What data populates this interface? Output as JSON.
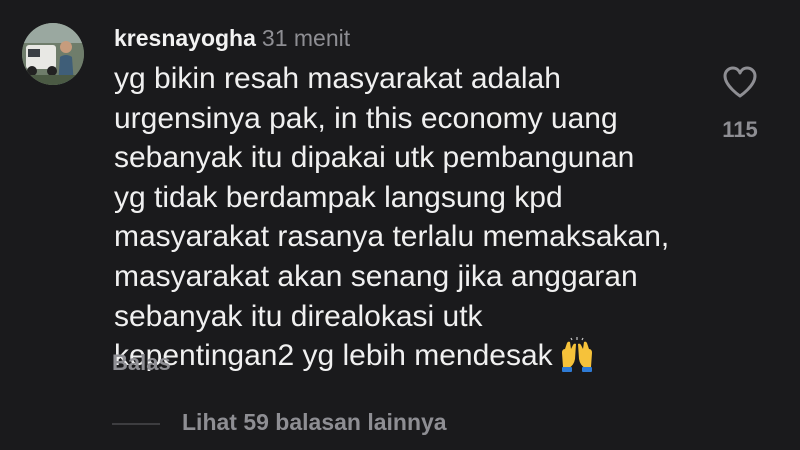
{
  "comment": {
    "username": "kresnayogha",
    "time": "31 menit",
    "lines": [
      "yg bikin resah masyarakat adalah",
      "urgensinya pak, in this economy uang",
      "sebanyak itu dipakai utk pembangunan",
      "yg tidak berdampak langsung kpd",
      "masyarakat rasanya terlalu memaksakan,",
      "masyarakat akan senang jika anggaran",
      "sebanyak itu direalokasi utk",
      "kepentingan2 yg lebih mendesak"
    ],
    "emoji_icon": "raising-hands-icon",
    "reply_label": "Balas",
    "like_icon": "heart-icon",
    "like_count": "115",
    "view_replies_label": "Lihat 59 balasan lainnya"
  },
  "colors": {
    "background": "#1a1a1c",
    "text": "#f0f0f0",
    "secondary": "#8e8e93",
    "emoji": "#f6c23a"
  }
}
